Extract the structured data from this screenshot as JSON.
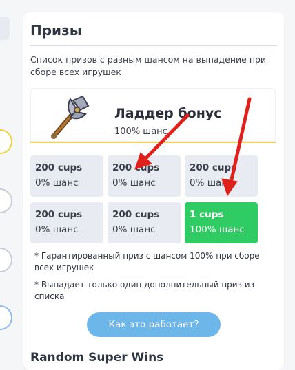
{
  "panel": {
    "title": "Призы",
    "description": "Список призов с разным шансом на выпадение при сборе всех игрушек",
    "bonus": {
      "title": "Ладдер бонус",
      "chance": "100% шанс",
      "icon": "battle-axe-icon"
    },
    "prizes": [
      {
        "value": "200 cups",
        "chance": "0% шанс",
        "highlight": false
      },
      {
        "value": "200 cups",
        "chance": "0% шанс",
        "highlight": false
      },
      {
        "value": "200 cups",
        "chance": "0% шанс",
        "highlight": false
      },
      {
        "value": "200 cups",
        "chance": "0% шанс",
        "highlight": false
      },
      {
        "value": "200 cups",
        "chance": "0% шанс",
        "highlight": false
      },
      {
        "value": "1 cups",
        "chance": "100% шанс",
        "highlight": true
      }
    ],
    "notes": [
      "* Гарантированный приз с шансом 100% при сборе всех игрушек",
      "* Выпадает только один дополнительный приз из списка"
    ],
    "how_button": "Как это работает?",
    "next_section_title": "Random Super Wins"
  },
  "colors": {
    "win": "#2fcb63",
    "button": "#6db6ea",
    "arrow": "#e0201b",
    "accent_line": "#f3d35a"
  }
}
